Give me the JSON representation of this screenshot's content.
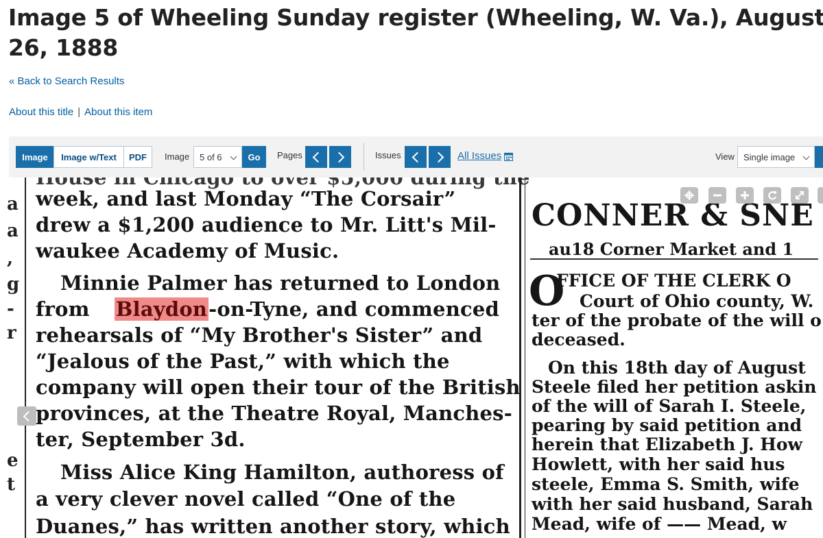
{
  "page": {
    "title": "Image 5 of Wheeling Sunday register (Wheeling, W. Va.), August 26, 1888",
    "back_link": "« Back to Search Results",
    "about_title": "About this title",
    "about_sep": "|",
    "about_item": "About this item"
  },
  "toolbar": {
    "tabs": [
      {
        "label": "Image",
        "active": true
      },
      {
        "label": "Image w/Text",
        "active": false
      },
      {
        "label": "PDF",
        "active": false
      }
    ],
    "image_label": "Image",
    "image_select": "5 of 6",
    "go_label": "Go",
    "pages_label": "Pages",
    "issues_label": "Issues",
    "all_issues": "All Issues",
    "view_label": "View",
    "view_select": "Single image"
  },
  "viewer": {
    "left_fragments": [
      "a",
      "a",
      ",",
      "g",
      "-",
      "r",
      "e",
      "t"
    ],
    "left_column": [
      "House in Chicago to over $5,000 during the",
      "week, and last Monday “The Corsair”",
      "drew a $1,200 audience  to Mr. Litt's Mil-",
      "waukee Academy of Music.",
      "Minnie Palmer has returned to London",
      "from",
      "Blaydon",
      "-on-Tyne, and commenced",
      "rehearsals of “My Brother's Sister” and",
      "“Jealous of  the  Past,” with which the",
      "company will open their tour of the British",
      "provinces, at the Theatre Royal, Manches-",
      "ter, September 3d.",
      "Miss Alice King Hamilton, authoress of",
      "a very clever novel called “One of the",
      "Duanes,” has written another story, which"
    ],
    "right_column": [
      "CONNER & SNE",
      "au18     Corner Market and 1",
      "FFICE OF THE CLERK O",
      "Court of Ohio county, W.",
      "ter of the probate of the will o",
      "deceased.",
      "On this 18th day of August",
      "Steele filed her petition askin",
      "of the will of Sarah I. Steele,",
      "pearing by said petition and",
      "herein that Elizabeth J. How",
      "Howlett, with her said hus",
      "steele, Emma S. Smith, wife",
      "with her said husband, Sarah",
      "Mead, wife of —— Mead, w"
    ],
    "drop_cap": "O"
  },
  "colors": {
    "link": "#0060a0",
    "accent": "#1a6faa",
    "highlight": "#f08a88",
    "toolbar_bg": "#f2f2f2"
  },
  "icons": [
    "chevron-left-icon",
    "chevron-right-icon",
    "calendar-icon",
    "chevron-down-icon",
    "home-icon",
    "zoom-out-icon",
    "zoom-in-icon",
    "rotate-icon",
    "fullscreen-icon"
  ]
}
